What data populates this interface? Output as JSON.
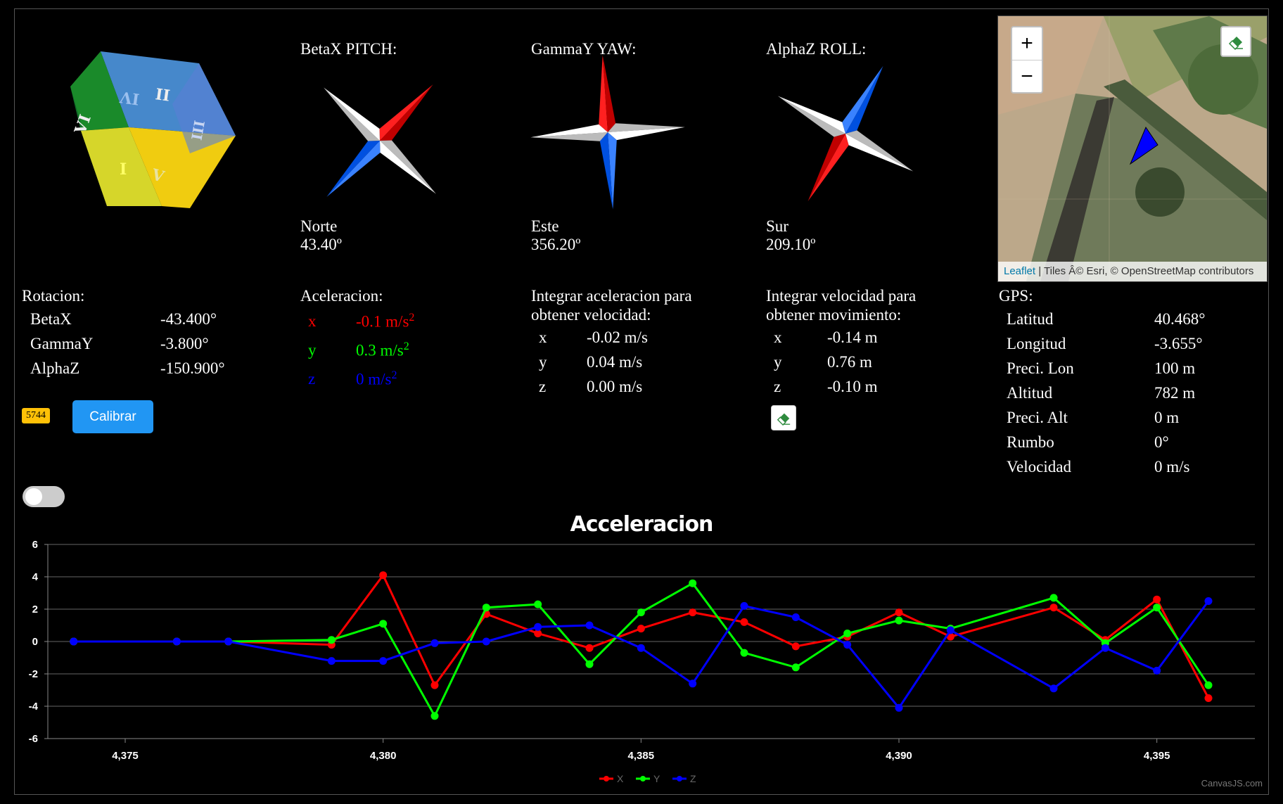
{
  "orientation": {
    "pitch": {
      "title": "BetaX PITCH:",
      "dir": "Norte",
      "deg": "43.40º"
    },
    "yaw": {
      "title": "GammaY YAW:",
      "dir": "Este",
      "deg": "356.20º"
    },
    "roll": {
      "title": "AlphaZ ROLL:",
      "dir": "Sur",
      "deg": "209.10º"
    }
  },
  "cube_faces": [
    "II",
    "IV",
    "III",
    "VI",
    "I",
    "V"
  ],
  "map": {
    "zoom_in": "+",
    "zoom_out": "−",
    "attribution_link": "Leaflet",
    "attribution_text": " | Tiles Â© Esri, © OpenStreetMap contributors"
  },
  "rotacion": {
    "title": "Rotacion:",
    "rows": [
      {
        "label": "BetaX",
        "value": "-43.400°"
      },
      {
        "label": "GammaY",
        "value": "-3.800°"
      },
      {
        "label": "AlphaZ",
        "value": "-150.900°"
      }
    ]
  },
  "aceleracion": {
    "title": "Aceleracion:",
    "rows": [
      {
        "label": "x",
        "value": "-0.1 m/s",
        "exp": "2",
        "color": "#ff0000"
      },
      {
        "label": "y",
        "value": "0.3 m/s",
        "exp": "2",
        "color": "#00ff00"
      },
      {
        "label": "z",
        "value": "0 m/s",
        "exp": "2",
        "color": "#0000ff"
      }
    ]
  },
  "velocidad": {
    "title_line1": "Integrar aceleracion para",
    "title_line2": "obtener velocidad:",
    "rows": [
      {
        "label": "x",
        "value": "-0.02 m/s"
      },
      {
        "label": "y",
        "value": "0.04 m/s"
      },
      {
        "label": "z",
        "value": "0.00 m/s"
      }
    ]
  },
  "movimiento": {
    "title_line1": "Integrar velocidad para",
    "title_line2": "obtener movimiento:",
    "rows": [
      {
        "label": "x",
        "value": "-0.14 m"
      },
      {
        "label": "y",
        "value": "0.76 m"
      },
      {
        "label": "z",
        "value": "-0.10 m"
      }
    ]
  },
  "gps": {
    "title": "GPS:",
    "rows": [
      {
        "label": "Latitud",
        "value": "40.468°"
      },
      {
        "label": "Longitud",
        "value": "-3.655°"
      },
      {
        "label": "Preci. Lon",
        "value": "100 m"
      },
      {
        "label": "Altitud",
        "value": "782 m"
      },
      {
        "label": "Preci. Alt",
        "value": "0 m"
      },
      {
        "label": "Rumbo",
        "value": "0°"
      },
      {
        "label": "Velocidad",
        "value": "0 m/s"
      }
    ]
  },
  "counter_badge": "5744",
  "calibrate_label": "Calibrar",
  "toggle_on": false,
  "credit": "CanvasJS.com",
  "chart_data": {
    "type": "line",
    "title": "Acceleracion",
    "ylim": [
      -6,
      6
    ],
    "yticks": [
      -6,
      -4,
      -2,
      0,
      2,
      4,
      6
    ],
    "xlim": [
      4373.5,
      4396.9
    ],
    "xticks": [
      4375,
      4380,
      4385,
      4390,
      4395
    ],
    "xtick_labels": [
      "4,375",
      "4,380",
      "4,385",
      "4,390",
      "4,395"
    ],
    "grid": true,
    "legend_position": "bottom",
    "x": [
      4374,
      4376,
      4377,
      4379,
      4380,
      4381,
      4382,
      4383,
      4384,
      4385,
      4386,
      4387,
      4388,
      4389,
      4390,
      4391,
      4393,
      4394,
      4395,
      4396
    ],
    "series": [
      {
        "name": "X",
        "color": "#ff0000",
        "values": [
          0,
          0,
          0,
          -0.2,
          4.1,
          -2.7,
          1.7,
          0.5,
          -0.4,
          0.8,
          1.8,
          1.2,
          -0.3,
          0.3,
          1.8,
          0.3,
          2.1,
          0.1,
          2.6,
          -3.5
        ]
      },
      {
        "name": "Y",
        "color": "#00ff00",
        "values": [
          0,
          0,
          0,
          0.1,
          1.1,
          -4.6,
          2.1,
          2.3,
          -1.4,
          1.8,
          3.6,
          -0.7,
          -1.6,
          0.5,
          1.3,
          0.8,
          2.7,
          -0.1,
          2.1,
          -2.7
        ]
      },
      {
        "name": "Z",
        "color": "#0000ff",
        "values": [
          0,
          0,
          0,
          -1.2,
          -1.2,
          -0.1,
          0,
          0.9,
          1.0,
          -0.4,
          -2.6,
          2.2,
          1.5,
          -0.2,
          -4.1,
          0.7,
          -2.9,
          -0.4,
          -1.8,
          2.5
        ]
      }
    ]
  }
}
